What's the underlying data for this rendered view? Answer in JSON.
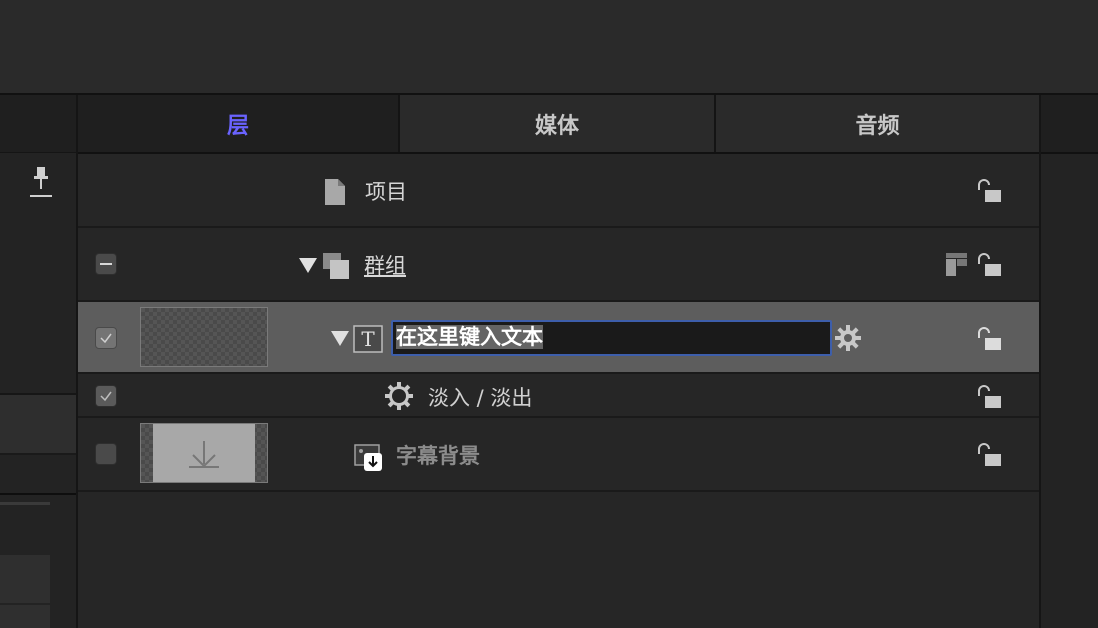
{
  "tabs": [
    {
      "label": "层",
      "active": true
    },
    {
      "label": "媒体",
      "active": false
    },
    {
      "label": "音频",
      "active": false
    }
  ],
  "layers": {
    "project": {
      "label": "项目",
      "icon": "document-icon"
    },
    "group": {
      "label": "群组",
      "icon": "group-icon",
      "checkbox": "mixed"
    },
    "text_layer": {
      "name_value": "在这里键入文本",
      "icon": "text-t-icon",
      "checked": true,
      "selected": true
    },
    "behavior": {
      "label": "淡入 / 淡出",
      "icon": "gear-behavior-icon",
      "checked": true
    },
    "drop_zone": {
      "label": "字幕背景",
      "icon": "drop-zone-icon",
      "checked": false
    }
  },
  "colors": {
    "active_tab": "#6a63ff",
    "selection_row": "#5d5d5d",
    "input_border": "#3d5eab"
  }
}
